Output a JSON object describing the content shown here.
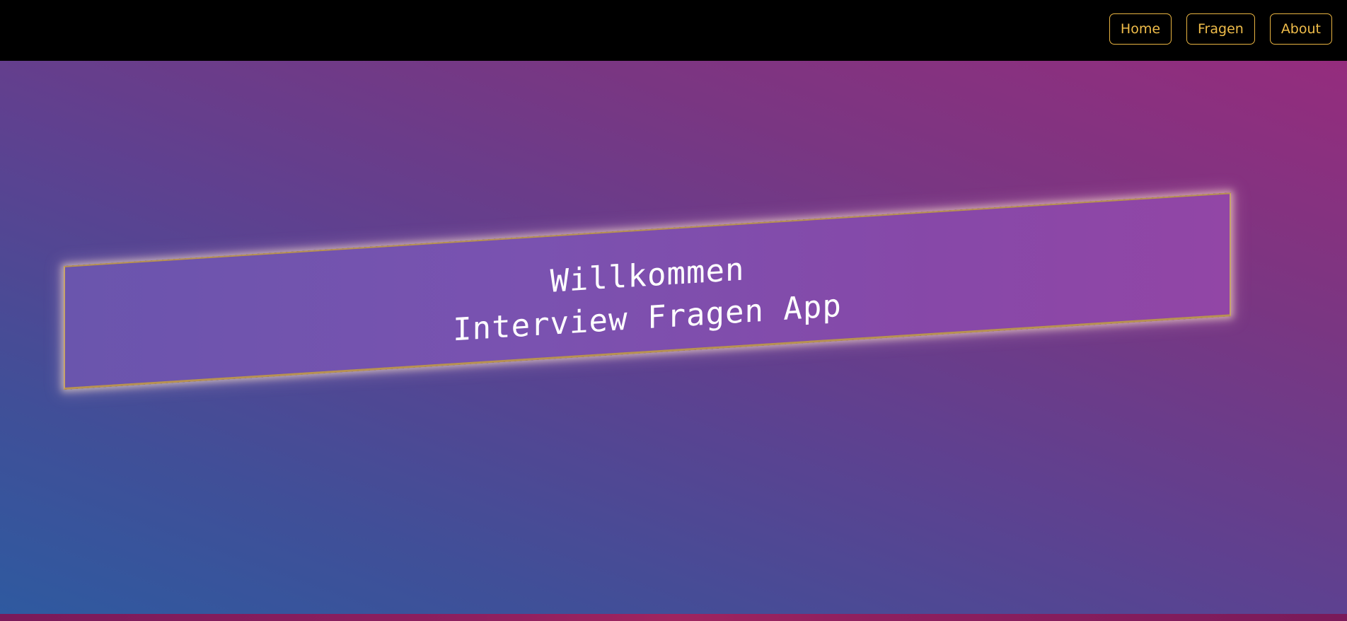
{
  "nav": {
    "home_label": "Home",
    "fragen_label": "Fragen",
    "about_label": "About"
  },
  "hero": {
    "line1": "Willkommen",
    "line2": "Interview Fragen App"
  },
  "colors": {
    "nav_accent": "#e8b341",
    "topbar_bg": "#000000",
    "banner_border": "#b89252",
    "gradient_top_right": "#9b2a7c",
    "gradient_bottom_left": "#2e5aa0"
  }
}
